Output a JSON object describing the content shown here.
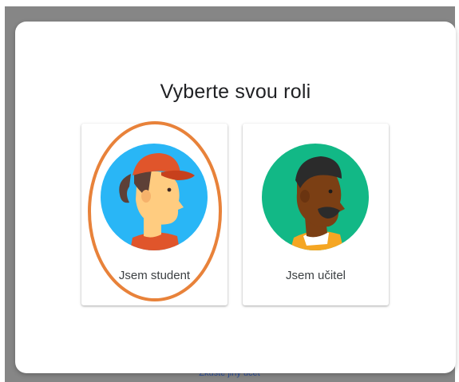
{
  "dialog": {
    "title": "Vyberte svou roli",
    "roles": [
      {
        "label": "Jsem student",
        "avatar": "student-avatar"
      },
      {
        "label": "Jsem učitel",
        "avatar": "teacher-avatar"
      }
    ],
    "highlighted_role": "Jsem student"
  },
  "background": {
    "link_text": "Zkuste jiný účet"
  },
  "colors": {
    "student_circle": "#29b6f6",
    "teacher_circle": "#12b886",
    "highlight_ring": "#e8823a",
    "overlay": "#868686"
  }
}
